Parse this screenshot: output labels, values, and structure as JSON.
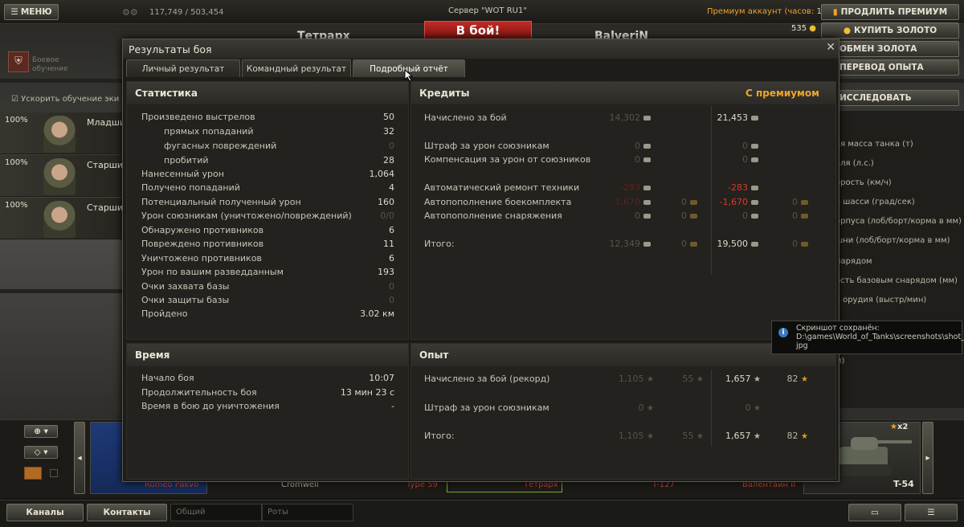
{
  "topbar": {
    "menu": "МЕНЮ",
    "xp": "117,749 / 503,454",
    "server": "Сервер \"WOT RU1\"",
    "battle_button": "В бой!",
    "player_left": "Тетрарх",
    "player_right": "BalveriN",
    "premium": "Премиум аккаунт (часов:",
    "premium_hours": "12)",
    "gold": "535",
    "buttons": [
      "ПРОДЛИТЬ ПРЕМИУМ",
      "КУПИТЬ ЗОЛОТО",
      "ОБМЕН ЗОЛОТА",
      "ПЕРЕВОД ОПЫТА"
    ]
  },
  "hangar": {
    "training": [
      "Боевое",
      "обучение"
    ],
    "accelerate": "Ускорить обучение эки",
    "crew": [
      {
        "pct": "100%",
        "name": "Младши"
      },
      {
        "pct": "100%",
        "name": "Старшин"
      },
      {
        "pct": "100%",
        "name": "Старшин"
      }
    ],
    "research": "ИССЛЕДОВАТЬ",
    "right_items": [
      "ая масса танка (т)",
      "еля (л.с.)",
      "орость (км/ч)",
      "а шасси (град/сек)",
      "орпуса (лоб/борт/корма в мм)",
      "шни (лоб/борт/корма в мм)",
      "нарядом",
      "ость базовым снарядом (мм)",
      "ь орудия (выстр/мин)",
      "м)"
    ]
  },
  "dialog": {
    "title": "Результаты боя",
    "tabs": [
      "Личный результат",
      "Командный результат",
      "Подробный отчёт"
    ],
    "stats": {
      "header": "Статистика",
      "rows": [
        {
          "label": "Произведено выстрелов",
          "value": "50"
        },
        {
          "label": "прямых попаданий",
          "value": "32"
        },
        {
          "label": "фугасных повреждений",
          "value": "0"
        },
        {
          "label": "пробитий",
          "value": "28"
        },
        {
          "label": "Нанесенный урон",
          "value": "1,064"
        },
        {
          "label": "Получено попаданий",
          "value": "4"
        },
        {
          "label": "Потенциальный полученный урон",
          "value": "160"
        },
        {
          "label": "Урон союзникам (уничтожено/повреждений)",
          "value": "0/0"
        },
        {
          "label": "Обнаружено противников",
          "value": "6"
        },
        {
          "label": "Повреждено противников",
          "value": "11"
        },
        {
          "label": "Уничтожено противников",
          "value": "6"
        },
        {
          "label": "Урон по вашим разведданным",
          "value": "193"
        },
        {
          "label": "Очки захвата базы",
          "value": "0"
        },
        {
          "label": "Очки защиты базы",
          "value": "0"
        },
        {
          "label": "Пройдено",
          "value": "3.02 км"
        }
      ]
    },
    "credits": {
      "header": "Кредиты",
      "premium_header": "С премиумом",
      "rows": [
        {
          "label": "Начислено за бой",
          "base": "14,302",
          "prem": "21,453"
        },
        {
          "label": "Штраф за урон союзникам",
          "base": "0",
          "prem": "0"
        },
        {
          "label": "Компенсация за урон от союзников",
          "base": "0",
          "prem": "0"
        },
        {
          "label": "Автоматический ремонт техники",
          "base": "-283",
          "prem": "-283"
        },
        {
          "label": "Автопополнение боекомплекта",
          "base": "-1,670",
          "base2": "0",
          "prem": "-1,670",
          "prem2": "0"
        },
        {
          "label": "Автопополнение снаряжения",
          "base": "0",
          "base2": "0",
          "prem": "0",
          "prem2": "0"
        },
        {
          "label": "Итого:",
          "base": "12,349",
          "base2": "0",
          "prem": "19,500",
          "prem2": "0"
        }
      ]
    },
    "time": {
      "header": "Время",
      "rows": [
        {
          "label": "Начало боя",
          "value": "10:07"
        },
        {
          "label": "Продолжительность боя",
          "value": "13 мин 23 с"
        },
        {
          "label": "Время в бою до уничтожения",
          "value": "-"
        }
      ]
    },
    "exp": {
      "header": "Опыт",
      "rows": [
        {
          "label": "Начислено за бой (рекорд)",
          "base": "1,105",
          "base2": "55",
          "prem": "1,657",
          "prem2": "82"
        },
        {
          "label": "Штраф за урон союзникам",
          "base": "0",
          "prem": "0"
        },
        {
          "label": "Итого:",
          "base": "1,105",
          "base2": "55",
          "prem": "1,657",
          "prem2": "82"
        }
      ]
    }
  },
  "tooltip": {
    "line1": "Скриншот сохранён:",
    "line2": "D:\\games\\World_of_Tanks\\screenshots\\shot_009.",
    "line3": "jpg"
  },
  "carousel": {
    "tank_name": "T-54",
    "multiplier": "x2",
    "slot_names": [
      "Romeo Pakvo",
      "Cromwell",
      "Type 59",
      "Тетрарх",
      "T-127",
      "Валентайн II"
    ]
  },
  "bottom": {
    "channels": "Каналы",
    "contacts": "Контакты",
    "common": "Общий",
    "companies": "Роты"
  }
}
